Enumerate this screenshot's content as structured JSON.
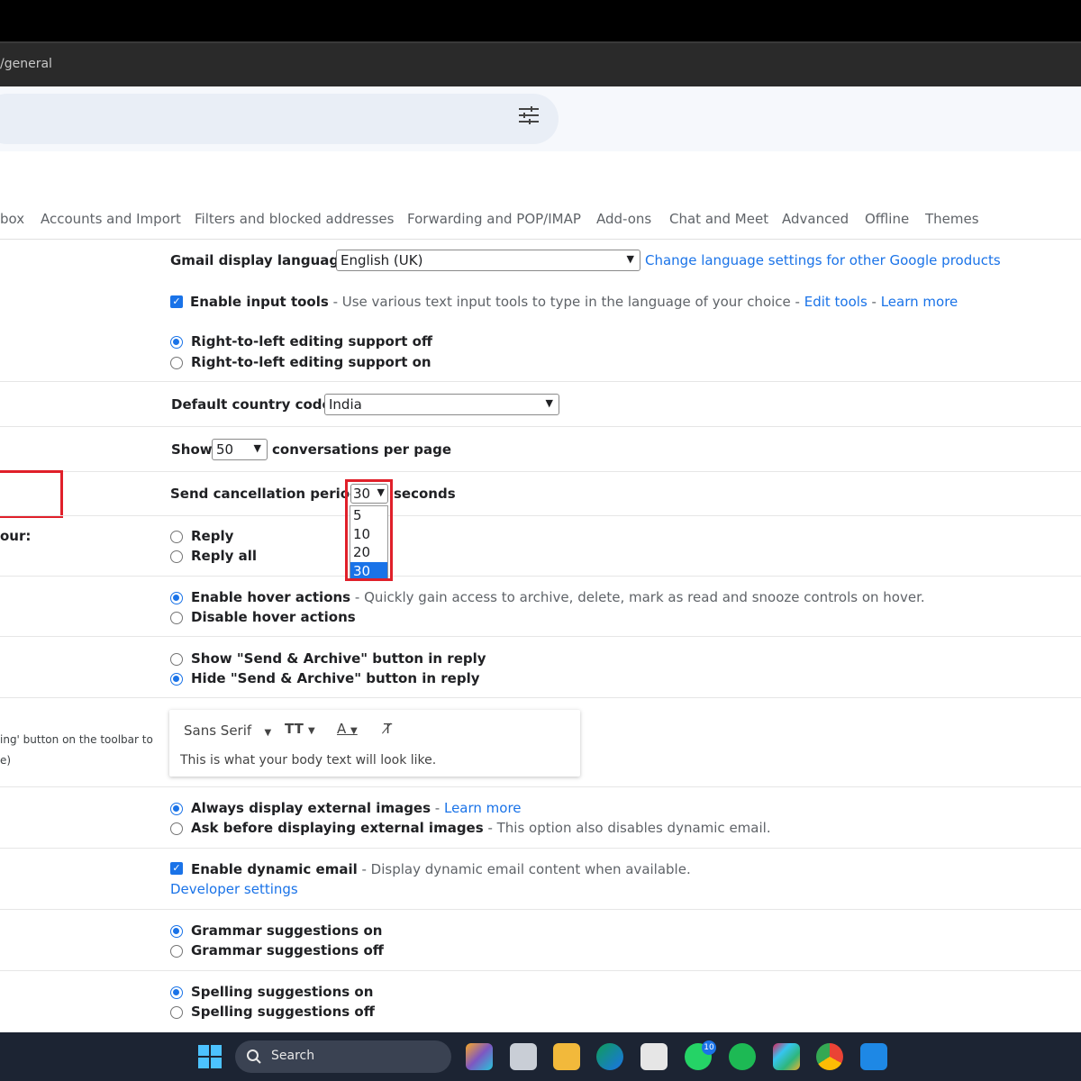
{
  "browser": {
    "url_fragment": "/general"
  },
  "tabs": [
    "box",
    "Accounts and Import",
    "Filters and blocked addresses",
    "Forwarding and POP/IMAP",
    "Add-ons",
    "Chat and Meet",
    "Advanced",
    "Offline",
    "Themes"
  ],
  "language": {
    "label": "Gmail display language:",
    "value": "English (UK)",
    "link": "Change language settings for other Google products"
  },
  "input_tools": {
    "label": "Enable input tools",
    "desc": " - Use various text input tools to type in the language of your choice - ",
    "edit_link": "Edit tools",
    "sep": " - ",
    "learn_link": "Learn more"
  },
  "rtl": {
    "off": "Right-to-left editing support off",
    "on": "Right-to-left editing support on"
  },
  "country": {
    "label": "Default country code:",
    "value": "India"
  },
  "page_size": {
    "label": "Show",
    "value": "50",
    "suffix": "conversations per page"
  },
  "undo_send": {
    "label": "Send cancellation period:",
    "value": "30",
    "suffix": "seconds",
    "options": [
      "5",
      "10",
      "20",
      "30"
    ],
    "selected": "30"
  },
  "reply": {
    "left_label": "our:",
    "reply": "Reply",
    "reply_all": "Reply all"
  },
  "hover": {
    "enable": "Enable hover actions",
    "enable_desc": " - Quickly gain access to archive, delete, mark as read and snooze controls on hover.",
    "disable": "Disable hover actions"
  },
  "send_archive": {
    "show": "Show \"Send & Archive\" button in reply",
    "hide": "Hide \"Send & Archive\" button in reply"
  },
  "text_style": {
    "left_line1": "ing' button on the toolbar to",
    "left_line2": "e)",
    "font": "Sans Serif",
    "sample": "This is what your body text will look like."
  },
  "images": {
    "always": "Always display external images",
    "always_sep": " - ",
    "always_link": "Learn more",
    "ask": "Ask before displaying external images",
    "ask_desc": " - This option also disables dynamic email."
  },
  "dynamic": {
    "label": "Enable dynamic email",
    "desc": " - Display dynamic email content when available.",
    "link": "Developer settings"
  },
  "grammar": {
    "on": "Grammar suggestions on",
    "off": "Grammar suggestions off"
  },
  "spelling": {
    "on": "Spelling suggestions on",
    "off": "Spelling suggestions off"
  },
  "taskbar": {
    "search": "Search",
    "whatsapp_badge": "10"
  },
  "colors": {
    "accent": "#1a73e8",
    "highlight": "#e0202a"
  }
}
